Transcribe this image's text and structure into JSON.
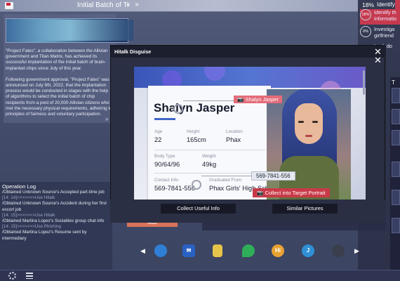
{
  "topbar": {
    "doc_title": "Initial Batch of Ti",
    "nav_arrows": "« »"
  },
  "document": {
    "paragraph_1": "\"Project Fates\", a collaboration between the Allivian government and Titan Matrix, has achieved its successful implantation of the initial batch of brain-implanted chips since July of this year.",
    "paragraph_2": "Following government approval, \"Project Fates\" was announced on July 9th, 2022, that the implantation process would be conducted in stages with the help of algorithms to select the initial batch of chip recipients from a pool of 20,000 Allivian citizens who met the necessary physical requirements, adhering to principles of fairness and voluntary participation.",
    "scroll_arrow": "»"
  },
  "notifications": {
    "top_percent": "18%",
    "top_text": "Identify th",
    "items": [
      {
        "percent": "18%",
        "text_1": "Identify th",
        "text_2": "informatio",
        "highlight": true
      },
      {
        "percent": "0%",
        "text_1": "Investiga",
        "text_2": "girlfriend",
        "highlight": false
      },
      {
        "percent": "",
        "text_1": "Look do",
        "text_2": "",
        "highlight": false
      }
    ],
    "strip_label": "T"
  },
  "oplog": {
    "title": "Operation Log",
    "entries": [
      {
        "text": "/Obtained Unknown Source's Accepted part-time job",
        "system": false
      },
      {
        "text": "[14: 14]>>>>>>>Use Hitalk",
        "system": true
      },
      {
        "text": "/Obtained Unknown Source's Accident during her first escort job",
        "system": false
      },
      {
        "text": "[14: 15]>>>>>>>Use Hitalk",
        "system": true
      },
      {
        "text": "/Obtained Martina Lopez's Socialites group chat info",
        "system": false
      },
      {
        "text": "[14: 15]>>>>>>>Use Phishing",
        "system": true
      },
      {
        "text": "/Obtained Martina Lopez's Resume sent by intermediary",
        "system": false
      }
    ]
  },
  "dock": {
    "left_arrow": "◀",
    "right_arrow": "▶",
    "apps": [
      {
        "name": "globe-app",
        "glyph": "",
        "color": "#2f7fd6"
      },
      {
        "name": "mail-app",
        "glyph": "✉",
        "color": "#2a62c4"
      },
      {
        "name": "notes-app",
        "glyph": "",
        "color": "#e6c44a"
      },
      {
        "name": "location-app",
        "glyph": "",
        "color": "#2fae5a"
      },
      {
        "name": "hitalk-app",
        "glyph": "Hi",
        "color": "#e9a232"
      },
      {
        "name": "phishing-app",
        "glyph": "J",
        "color": "#2f90d6"
      },
      {
        "name": "bird-app",
        "glyph": "",
        "color": "#3b3f4c"
      }
    ]
  },
  "add_button": "Add",
  "modal": {
    "title": "Hitalk Disguise",
    "close": "✕",
    "profile": {
      "name": "Shalyn Jasper",
      "fields": {
        "age_label": "Age",
        "age": "22",
        "height_label": "Height",
        "height": "165cm",
        "location_label": "Location",
        "location": "Phax",
        "body_type_label": "Body Type",
        "body_type": "90/64/96",
        "weight_label": "Weight",
        "weight": "49kg",
        "contact_label": "Contact Info",
        "contact": "569-7841-556",
        "graduated_label": "Graduated From",
        "graduated": "Phax Girls' High School"
      },
      "name_tag": "Shalyn Jasper",
      "phone_tag": "569-7841-556",
      "collect_tag": "Collect into Target Portrait",
      "camera_glyph": "📷"
    },
    "buttons": {
      "collect": "Collect Useful Info",
      "similar": "Similar Pictures"
    }
  },
  "colors": {
    "accent_red": "#c93a48",
    "accent_blue": "#3f67c6",
    "panel_dark": "#2b2f43"
  }
}
